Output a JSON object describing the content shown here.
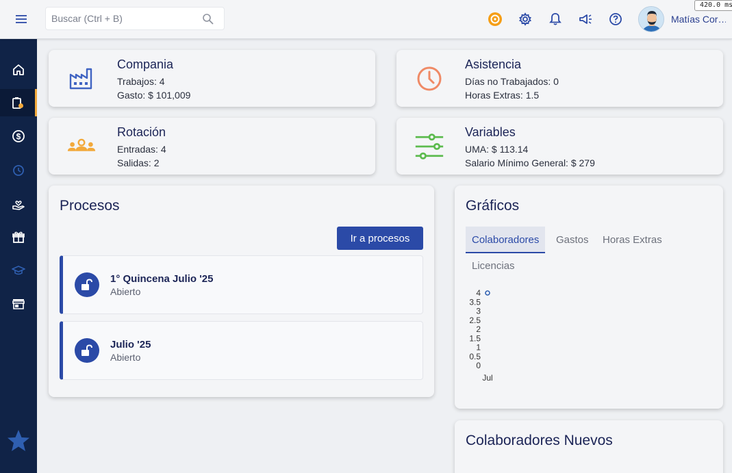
{
  "header": {
    "search_placeholder": "Buscar (Ctrl + B)",
    "user_name": "Matías Cor…",
    "timing": "420.0 ms"
  },
  "stats": {
    "company": {
      "title": "Compania",
      "line1": "Trabajos: 4",
      "line2": "Gasto: $ 101,009"
    },
    "attendance": {
      "title": "Asistencia",
      "line1": "Días no Trabajados: 0",
      "line2": "Horas Extras: 1.5"
    },
    "rotation": {
      "title": "Rotación",
      "line1": "Entradas: 4",
      "line2": "Salidas: 2"
    },
    "variables": {
      "title": "Variables",
      "line1": "UMA: $ 113.14",
      "line2": "Salario Mínimo General: $ 279"
    }
  },
  "processes": {
    "title": "Procesos",
    "button_label": "Ir a procesos",
    "items": [
      {
        "title": "1° Quincena Julio '25",
        "status": "Abierto"
      },
      {
        "title": "Julio '25",
        "status": "Abierto"
      }
    ]
  },
  "charts": {
    "title": "Gráficos",
    "tabs": [
      "Colaboradores",
      "Gastos",
      "Horas Extras",
      "Licencias"
    ],
    "active_tab": "Colaboradores"
  },
  "new_collaborators": {
    "title": "Colaboradores Nuevos"
  },
  "chart_data": {
    "type": "scatter",
    "categories": [
      "Jul"
    ],
    "values": [
      4
    ],
    "yticks": [
      "4",
      "3.5",
      "3",
      "2.5",
      "2",
      "1.5",
      "1",
      "0.5",
      "0"
    ],
    "ylim": [
      0,
      4
    ],
    "xlabel": "",
    "ylabel": ""
  },
  "colors": {
    "primary": "#2b4aa7",
    "sidebar": "#102347",
    "accent": "#f2a93b",
    "attendance_icon": "#ef8a66",
    "variables_icon": "#5cbb4e",
    "company_icon": "#3f63c2"
  },
  "icons": {
    "menu": "hamburger-icon",
    "search": "search-icon",
    "toolbar": [
      "coin-icon",
      "gear-icon",
      "bell-icon",
      "megaphone-icon",
      "help-icon"
    ],
    "sidebar": [
      "home-icon",
      "clipboard-icon",
      "dollar-icon",
      "clock-icon",
      "hand-heart-icon",
      "gift-icon",
      "graduation-cap-icon",
      "store-icon",
      "star-icon"
    ]
  }
}
